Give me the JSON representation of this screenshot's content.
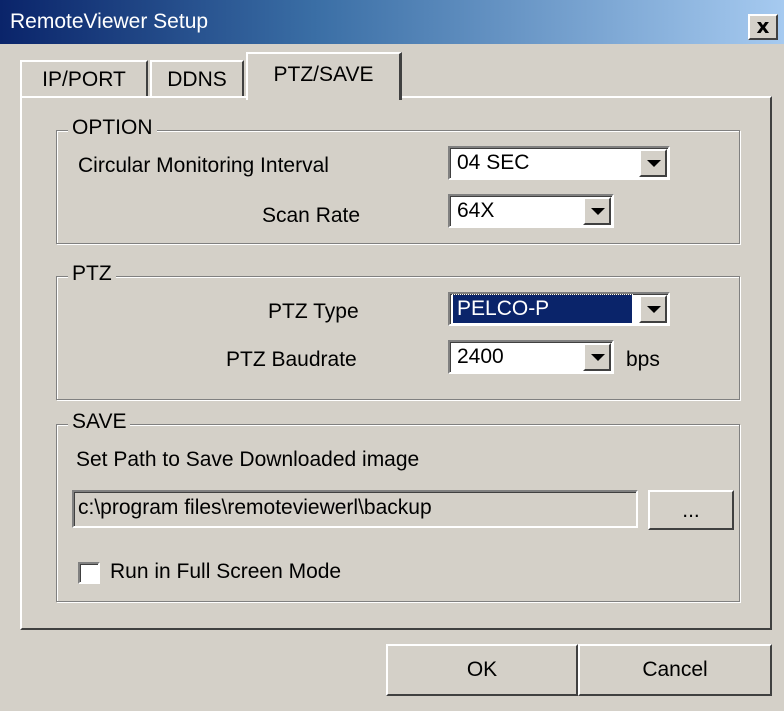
{
  "window": {
    "title": "RemoteViewer Setup",
    "close_label": "x"
  },
  "tabs": [
    {
      "label": "IP/PORT",
      "selected": false
    },
    {
      "label": "DDNS",
      "selected": false
    },
    {
      "label": "PTZ/SAVE",
      "selected": true
    }
  ],
  "option": {
    "group_label": "OPTION",
    "interval_label": "Circular Monitoring Interval",
    "interval_value": "04 SEC",
    "scan_rate_label": "Scan Rate",
    "scan_rate_value": "64X"
  },
  "ptz": {
    "group_label": "PTZ",
    "type_label": "PTZ Type",
    "type_value": "PELCO-P",
    "baudrate_label": "PTZ Baudrate",
    "baudrate_value": "2400",
    "baudrate_unit": "bps"
  },
  "save": {
    "group_label": "SAVE",
    "path_label": "Set Path to Save Downloaded image",
    "path_value": "c:\\program files\\remoteviewerl\\backup",
    "browse_label": "...",
    "fullscreen_label": "Run in Full Screen Mode",
    "fullscreen_checked": false
  },
  "buttons": {
    "ok_label": "OK",
    "cancel_label": "Cancel"
  },
  "colors": {
    "titlebar_start": "#0a246a",
    "titlebar_end": "#a6caf0",
    "face": "#d4d0c8",
    "selection": "#0a246a"
  }
}
